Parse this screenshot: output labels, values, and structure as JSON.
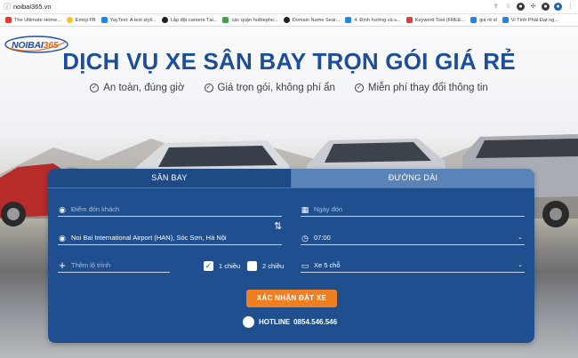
{
  "browser": {
    "url": "noibai365.vn",
    "bookmarks": [
      {
        "label": "The Ultimate Home...",
        "color": "#e53935"
      },
      {
        "label": "Emoji FB",
        "color": "#fbc02d"
      },
      {
        "label": "YayText: A text styli...",
        "color": "#1e88e5"
      },
      {
        "label": "Lắp đặt camera Tại...",
        "color": "#212121"
      },
      {
        "label": "các quận hutbepho...",
        "color": "#43a047"
      },
      {
        "label": "Domain Name Sear...",
        "color": "#212121"
      },
      {
        "label": "4. Định hướng và s...",
        "color": "#1e88e5"
      },
      {
        "label": "Keyword Tool (FREE...",
        "color": "#e53935"
      },
      {
        "label": "giá rẻ sl",
        "color": "#1e88e5"
      },
      {
        "label": "Vi Tính Phát Đạt ng...",
        "color": "#1e88e5"
      }
    ]
  },
  "brand": {
    "logo_main": "NOIBAI",
    "logo_accent": "365",
    "primary_color": "#1c4e9c",
    "accent_color": "#f07f22"
  },
  "hero": {
    "headline": "DỊCH VỤ XE SÂN BAY TRỌN GÓI GIÁ RẺ",
    "features": [
      "An toàn, đúng giờ",
      "Giá trọn gói, không phí ẩn",
      "Miễn phí thay đổi thông tin"
    ]
  },
  "booking": {
    "tabs": [
      {
        "label": "SÂN BAY",
        "active": true
      },
      {
        "label": "ĐƯỜNG DÀI",
        "active": false
      }
    ],
    "pickup_placeholder": "Điểm đón khách",
    "date_placeholder": "Ngày đón",
    "destination_value": "Noi Bai International Airport (HAN), Sóc Sơn, Hà Nội",
    "time_value": "07:00",
    "add_stop_placeholder": "Thêm lộ trình",
    "trip_options": [
      {
        "label": "1 chiều",
        "checked": true
      },
      {
        "label": "2 chiều",
        "checked": false
      }
    ],
    "vehicle_value": "Xe 5 chỗ",
    "submit_label": "XÁC NHẬN ĐẶT XE",
    "hotline_label": "HOTLINE",
    "hotline_number": "0854.546.546"
  }
}
